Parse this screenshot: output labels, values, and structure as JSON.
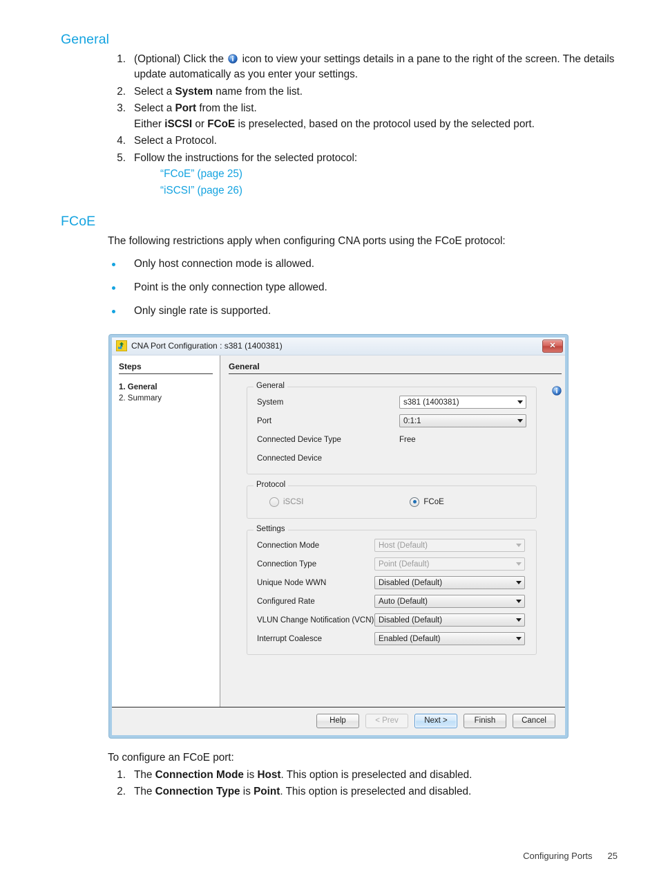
{
  "document": {
    "general_heading": "General",
    "steps": [
      {
        "num": "1.",
        "text_before_icon": "(Optional) Click the",
        "icon": "info-icon",
        "text_after_icon": "icon to view your settings details in a pane to the right of the screen. The details update automatically as you enter your settings."
      },
      {
        "num": "2.",
        "pre": "Select a ",
        "bold": "System",
        "post": " name from the list."
      },
      {
        "num": "3.",
        "pre": "Select a ",
        "bold": "Port",
        "post": " from the list.",
        "sub_pre": "Either ",
        "sub_bold1": "iSCSI",
        "sub_mid": " or ",
        "sub_bold2": "FCoE",
        "sub_post": " is preselected, based on the protocol used by the selected port."
      },
      {
        "num": "4.",
        "pre": "Select a Protocol.",
        "bold": "",
        "post": ""
      },
      {
        "num": "5.",
        "pre": "Follow the instructions for the selected protocol:",
        "bold": "",
        "post": ""
      }
    ],
    "links": [
      "“FCoE” (page 25)",
      "“iSCSI” (page 26)"
    ],
    "fcoe_heading": "FCoE",
    "fcoe_intro": "The following restrictions apply when configuring CNA ports using the FCoE protocol:",
    "fcoe_bullets": [
      "Only host connection mode is allowed.",
      "Point is the only connection type allowed.",
      "Only single rate is supported."
    ],
    "closing_intro": "To configure an FCoE port:",
    "closing_steps": [
      {
        "num": "1.",
        "pre": "The ",
        "bold1": "Connection Mode",
        "mid": " is ",
        "bold2": "Host",
        "post": ". This option is preselected and disabled."
      },
      {
        "num": "2.",
        "pre": "The ",
        "bold1": "Connection Type",
        "mid": " is ",
        "bold2": "Point",
        "post": ". This option is preselected and disabled."
      }
    ],
    "footer": {
      "chapter": "Configuring Ports",
      "page_number": "25"
    },
    "accent_color": "#14a3e0"
  },
  "dialog": {
    "title": "CNA Port Configuration : s381 (1400381)",
    "app_icon": "recycle-arrows-icon",
    "close_label": "✕",
    "steps_pane": {
      "header": "Steps",
      "items": [
        {
          "label": "1. General",
          "active": true
        },
        {
          "label": "2. Summary",
          "active": false
        }
      ]
    },
    "content_title": "General",
    "info_icon": "info-icon",
    "general_group": {
      "legend": "General",
      "system_label": "System",
      "system_value": "s381 (1400381)",
      "port_label": "Port",
      "port_value": "0:1:1",
      "connected_device_type_label": "Connected Device Type",
      "connected_device_type_value": "Free",
      "connected_device_label": "Connected Device",
      "connected_device_value": ""
    },
    "protocol_group": {
      "legend": "Protocol",
      "iscsi_label": "iSCSI",
      "fcoe_label": "FCoE",
      "selected": "FCoE"
    },
    "settings_group": {
      "legend": "Settings",
      "rows": [
        {
          "label": "Connection Mode",
          "value": "Host (Default)",
          "disabled": true
        },
        {
          "label": "Connection Type",
          "value": "Point (Default)",
          "disabled": true
        },
        {
          "label": "Unique Node WWN",
          "value": "Disabled (Default)",
          "disabled": false
        },
        {
          "label": "Configured Rate",
          "value": "Auto (Default)",
          "disabled": false
        },
        {
          "label": "VLUN Change Notification (VCN)",
          "value": "Disabled (Default)",
          "disabled": false
        },
        {
          "label": "Interrupt Coalesce",
          "value": "Enabled (Default)",
          "disabled": false
        }
      ]
    },
    "buttons": [
      {
        "label": "Help",
        "state": "normal"
      },
      {
        "label": "< Prev",
        "state": "disabled"
      },
      {
        "label": "Next >",
        "state": "default"
      },
      {
        "label": "Finish",
        "state": "normal"
      },
      {
        "label": "Cancel",
        "state": "normal"
      }
    ]
  }
}
